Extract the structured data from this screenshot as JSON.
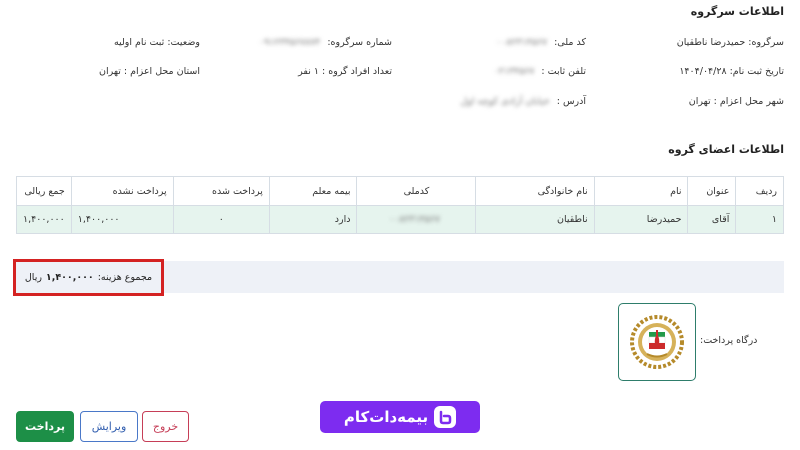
{
  "head_info": {
    "title": "اطلاعات سرگروه",
    "leader_label": "سرگروه:",
    "leader_value": "حمیدرضا ناطقیان",
    "national_code_label": "کد ملی:",
    "national_code_value": "۰۰۸۲۳۱۴۵۶۷",
    "group_number_label": "شماره سرگروه:",
    "group_number_value": "۰۹۱۲۳۴۵۶۷۸۷۴",
    "status_label": "وضعیت:",
    "status_value": "ثبت نام اولیه",
    "reg_date_label": "تاریخ ثبت نام:",
    "reg_date_value": "۱۴۰۴/۰۴/۲۸",
    "landline_label": "تلفن ثابت :",
    "landline_value": "۰۲۱۳۴۵۶۷",
    "group_count_label": "تعداد افراد گروه :",
    "group_count_value": "۱ نفر",
    "dispatch_province_label": "استان محل اعزام :",
    "dispatch_province_value": "تهران",
    "dispatch_city_label": "شهر محل اعزام :",
    "dispatch_city_value": "تهران",
    "address_label": "آدرس :",
    "address_value": "خیابان آزادی کوچه اول"
  },
  "members": {
    "title": "اطلاعات اعضای گروه",
    "columns": [
      "ردیف",
      "عنوان",
      "نام",
      "نام خانوادگی",
      "کدملی",
      "بیمه معلم",
      "پرداخت شده",
      "پرداخت نشده",
      "جمع ریالی"
    ],
    "rows": [
      {
        "row": "۱",
        "title": "آقای",
        "first_name": "حمیدرضا",
        "last_name": "ناطقیان",
        "national_code": "۰۰۸۲۳۱۴۵۶۷",
        "teacher_insurance": "دارد",
        "paid": "۰",
        "unpaid": "۱,۴۰۰,۰۰۰",
        "total": "۱,۴۰۰,۰۰۰"
      }
    ]
  },
  "total": {
    "label": "مجموع هزینه:",
    "amount": "۱,۴۰۰,۰۰۰",
    "unit": "ریال"
  },
  "payment": {
    "gateway_label": "درگاه پرداخت:",
    "bank_icon": "bank-melli-logo-icon"
  },
  "buttons": {
    "pay": "پرداخت",
    "edit": "ویرایش",
    "exit": "خروج"
  },
  "brand": {
    "logo_text": "بیمه‌دات‌کام",
    "color": "#7d2cf0"
  },
  "colors": {
    "row_bg": "#e6f4ee",
    "highlight_border": "#d42222",
    "pay_green": "#1d8f47",
    "edit_blue": "#3460b0",
    "exit_red": "#c63e57"
  }
}
